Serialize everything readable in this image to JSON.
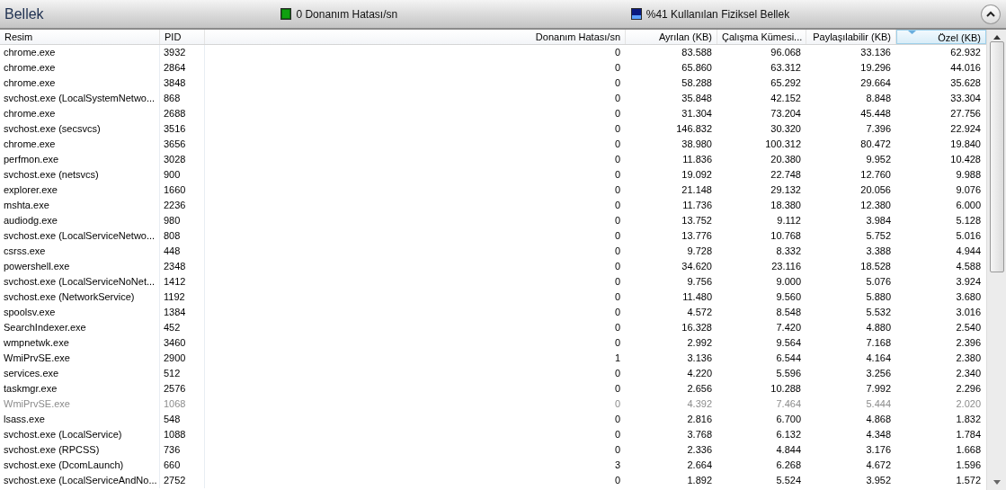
{
  "section": {
    "title": "Bellek",
    "expanded": true
  },
  "indicators": [
    {
      "kind": "hardfault",
      "text": "0 Donanım Hatası/sn"
    },
    {
      "kind": "memory",
      "text": "%41 Kullanılan Fiziksel Bellek"
    }
  ],
  "table": {
    "columns": [
      {
        "label": "Resim",
        "sorted": false
      },
      {
        "label": "PID",
        "sorted": false
      },
      {
        "label": "Donanım Hatası/sn",
        "sorted": false
      },
      {
        "label": "Ayrılan (KB)",
        "sorted": false
      },
      {
        "label": "Çalışma Kümesi...",
        "sorted": false
      },
      {
        "label": "Paylaşılabilir (KB)",
        "sorted": false
      },
      {
        "label": "Özel (KB)",
        "sorted": true
      }
    ],
    "rows": [
      {
        "dimmed": false,
        "cells": [
          "chrome.exe",
          "3932",
          "0",
          "83.588",
          "96.068",
          "33.136",
          "62.932"
        ]
      },
      {
        "dimmed": false,
        "cells": [
          "chrome.exe",
          "2864",
          "0",
          "65.860",
          "63.312",
          "19.296",
          "44.016"
        ]
      },
      {
        "dimmed": false,
        "cells": [
          "chrome.exe",
          "3848",
          "0",
          "58.288",
          "65.292",
          "29.664",
          "35.628"
        ]
      },
      {
        "dimmed": false,
        "cells": [
          "svchost.exe (LocalSystemNetwo...",
          "868",
          "0",
          "35.848",
          "42.152",
          "8.848",
          "33.304"
        ]
      },
      {
        "dimmed": false,
        "cells": [
          "chrome.exe",
          "2688",
          "0",
          "31.304",
          "73.204",
          "45.448",
          "27.756"
        ]
      },
      {
        "dimmed": false,
        "cells": [
          "svchost.exe (secsvcs)",
          "3516",
          "0",
          "146.832",
          "30.320",
          "7.396",
          "22.924"
        ]
      },
      {
        "dimmed": false,
        "cells": [
          "chrome.exe",
          "3656",
          "0",
          "38.980",
          "100.312",
          "80.472",
          "19.840"
        ]
      },
      {
        "dimmed": false,
        "cells": [
          "perfmon.exe",
          "3028",
          "0",
          "11.836",
          "20.380",
          "9.952",
          "10.428"
        ]
      },
      {
        "dimmed": false,
        "cells": [
          "svchost.exe (netsvcs)",
          "900",
          "0",
          "19.092",
          "22.748",
          "12.760",
          "9.988"
        ]
      },
      {
        "dimmed": false,
        "cells": [
          "explorer.exe",
          "1660",
          "0",
          "21.148",
          "29.132",
          "20.056",
          "9.076"
        ]
      },
      {
        "dimmed": false,
        "cells": [
          "mshta.exe",
          "2236",
          "0",
          "11.736",
          "18.380",
          "12.380",
          "6.000"
        ]
      },
      {
        "dimmed": false,
        "cells": [
          "audiodg.exe",
          "980",
          "0",
          "13.752",
          "9.112",
          "3.984",
          "5.128"
        ]
      },
      {
        "dimmed": false,
        "cells": [
          "svchost.exe (LocalServiceNetwo...",
          "808",
          "0",
          "13.776",
          "10.768",
          "5.752",
          "5.016"
        ]
      },
      {
        "dimmed": false,
        "cells": [
          "csrss.exe",
          "448",
          "0",
          "9.728",
          "8.332",
          "3.388",
          "4.944"
        ]
      },
      {
        "dimmed": false,
        "cells": [
          "powershell.exe",
          "2348",
          "0",
          "34.620",
          "23.116",
          "18.528",
          "4.588"
        ]
      },
      {
        "dimmed": false,
        "cells": [
          "svchost.exe (LocalServiceNoNet...",
          "1412",
          "0",
          "9.756",
          "9.000",
          "5.076",
          "3.924"
        ]
      },
      {
        "dimmed": false,
        "cells": [
          "svchost.exe (NetworkService)",
          "1192",
          "0",
          "11.480",
          "9.560",
          "5.880",
          "3.680"
        ]
      },
      {
        "dimmed": false,
        "cells": [
          "spoolsv.exe",
          "1384",
          "0",
          "4.572",
          "8.548",
          "5.532",
          "3.016"
        ]
      },
      {
        "dimmed": false,
        "cells": [
          "SearchIndexer.exe",
          "452",
          "0",
          "16.328",
          "7.420",
          "4.880",
          "2.540"
        ]
      },
      {
        "dimmed": false,
        "cells": [
          "wmpnetwk.exe",
          "3460",
          "0",
          "2.992",
          "9.564",
          "7.168",
          "2.396"
        ]
      },
      {
        "dimmed": false,
        "cells": [
          "WmiPrvSE.exe",
          "2900",
          "1",
          "3.136",
          "6.544",
          "4.164",
          "2.380"
        ]
      },
      {
        "dimmed": false,
        "cells": [
          "services.exe",
          "512",
          "0",
          "4.220",
          "5.596",
          "3.256",
          "2.340"
        ]
      },
      {
        "dimmed": false,
        "cells": [
          "taskmgr.exe",
          "2576",
          "0",
          "2.656",
          "10.288",
          "7.992",
          "2.296"
        ]
      },
      {
        "dimmed": true,
        "cells": [
          "WmiPrvSE.exe",
          "1068",
          "0",
          "4.392",
          "7.464",
          "5.444",
          "2.020"
        ]
      },
      {
        "dimmed": false,
        "cells": [
          "lsass.exe",
          "548",
          "0",
          "2.816",
          "6.700",
          "4.868",
          "1.832"
        ]
      },
      {
        "dimmed": false,
        "cells": [
          "svchost.exe (LocalService)",
          "1088",
          "0",
          "3.768",
          "6.132",
          "4.348",
          "1.784"
        ]
      },
      {
        "dimmed": false,
        "cells": [
          "svchost.exe (RPCSS)",
          "736",
          "0",
          "2.336",
          "4.844",
          "3.176",
          "1.668"
        ]
      },
      {
        "dimmed": false,
        "cells": [
          "svchost.exe (DcomLaunch)",
          "660",
          "3",
          "2.664",
          "6.268",
          "4.672",
          "1.596"
        ]
      },
      {
        "dimmed": false,
        "cells": [
          "svchost.exe (LocalServiceAndNo...",
          "2752",
          "0",
          "1.892",
          "5.524",
          "3.952",
          "1.572"
        ]
      }
    ]
  }
}
